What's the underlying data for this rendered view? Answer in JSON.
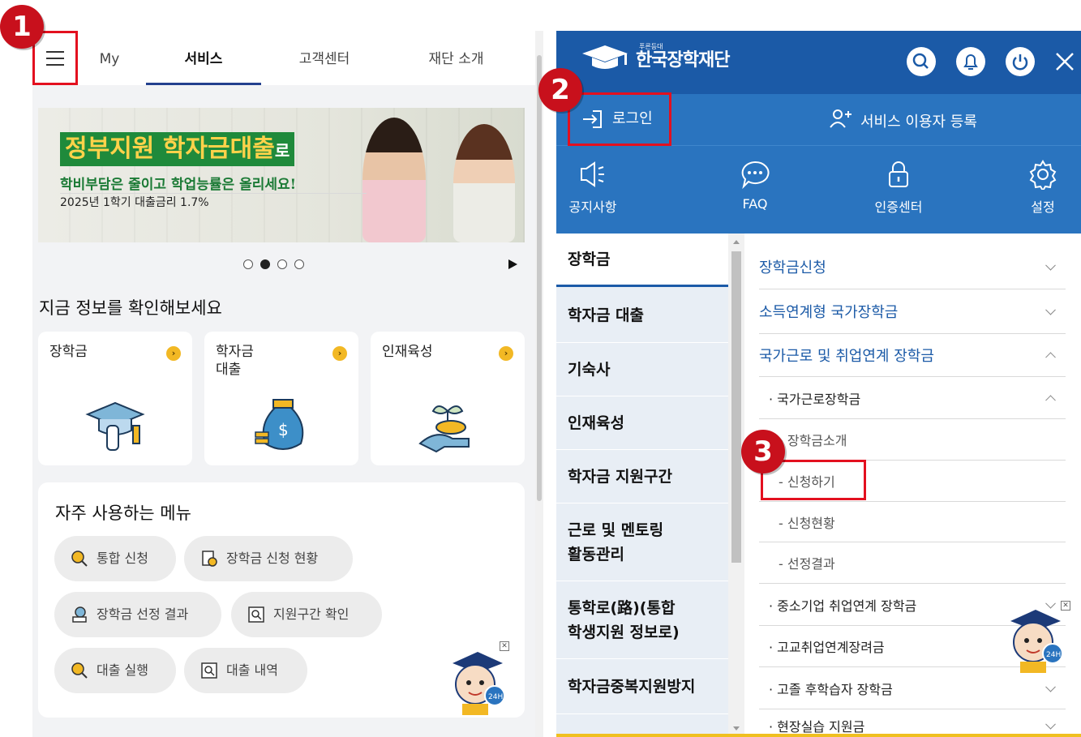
{
  "left": {
    "tabs": [
      {
        "label": "My"
      },
      {
        "label": "서비스"
      },
      {
        "label": "고객센터"
      },
      {
        "label": "재단 소개"
      }
    ],
    "banner": {
      "title_main": "정부지원 학자금대출",
      "title_suffix": "로",
      "subtitle": "학비부담은 줄이고 학업능률은 올리세요!",
      "rate": "2025년 1학기 대출금리 1.7%"
    },
    "section_title": "지금 정보를 확인해보세요",
    "cards": [
      {
        "label": "장학금"
      },
      {
        "label": "학자금\n대출"
      },
      {
        "label": "인재육성"
      }
    ],
    "frequent": {
      "title": "자주 사용하는 메뉴",
      "items": [
        {
          "label": "통합 신청"
        },
        {
          "label": "장학금 신청 현황"
        },
        {
          "label": "장학금 선정 결과"
        },
        {
          "label": "지원구간 확인"
        },
        {
          "label": "대출 실행"
        },
        {
          "label": "대출 내역"
        }
      ]
    },
    "close_mark": "✕"
  },
  "right": {
    "logo": {
      "small": "푸른등대",
      "name": "한국장학재단"
    },
    "login": "로그인",
    "register": "서비스 이용자 등록",
    "quick": [
      {
        "label": "공지사항",
        "icon": "megaphone-icon"
      },
      {
        "label": "FAQ",
        "icon": "chat-bubble-icon"
      },
      {
        "label": "인증센터",
        "icon": "lock-icon"
      },
      {
        "label": "설정",
        "icon": "gear-icon"
      }
    ],
    "nav": [
      {
        "label": "장학금"
      },
      {
        "label": "학자금 대출"
      },
      {
        "label": "기숙사"
      },
      {
        "label": "인재육성"
      },
      {
        "label": "학자금 지원구간"
      },
      {
        "label": "근로 및 멘토링\n활동관리"
      },
      {
        "label": "통학로(路)(통합\n학생지원 정보로)"
      },
      {
        "label": "학자금중복지원방지"
      }
    ],
    "submenu": [
      {
        "label": "장학금신청"
      },
      {
        "label": "소득연계형 국가장학금"
      },
      {
        "label": "국가근로 및 취업연계 장학금"
      },
      {
        "label": "· 국가근로장학금"
      },
      {
        "label": "- 장학금소개"
      },
      {
        "label": "- 신청하기"
      },
      {
        "label": "- 신청현황"
      },
      {
        "label": "- 선정결과"
      },
      {
        "label": "· 중소기업 취업연계 장학금"
      },
      {
        "label": "· 고교취업연계장려금"
      },
      {
        "label": "· 고졸 후학습자 장학금"
      },
      {
        "label": "· 현장실습 지원금"
      }
    ],
    "close_mark": "✕"
  },
  "badges": [
    "1",
    "2",
    "3"
  ],
  "colors": {
    "brand_blue": "#1b5aa7",
    "menu_blue": "#2a74bf",
    "highlight_red": "#e3101f",
    "badge_red": "#c8101c",
    "accent_yellow": "#f2b824"
  }
}
